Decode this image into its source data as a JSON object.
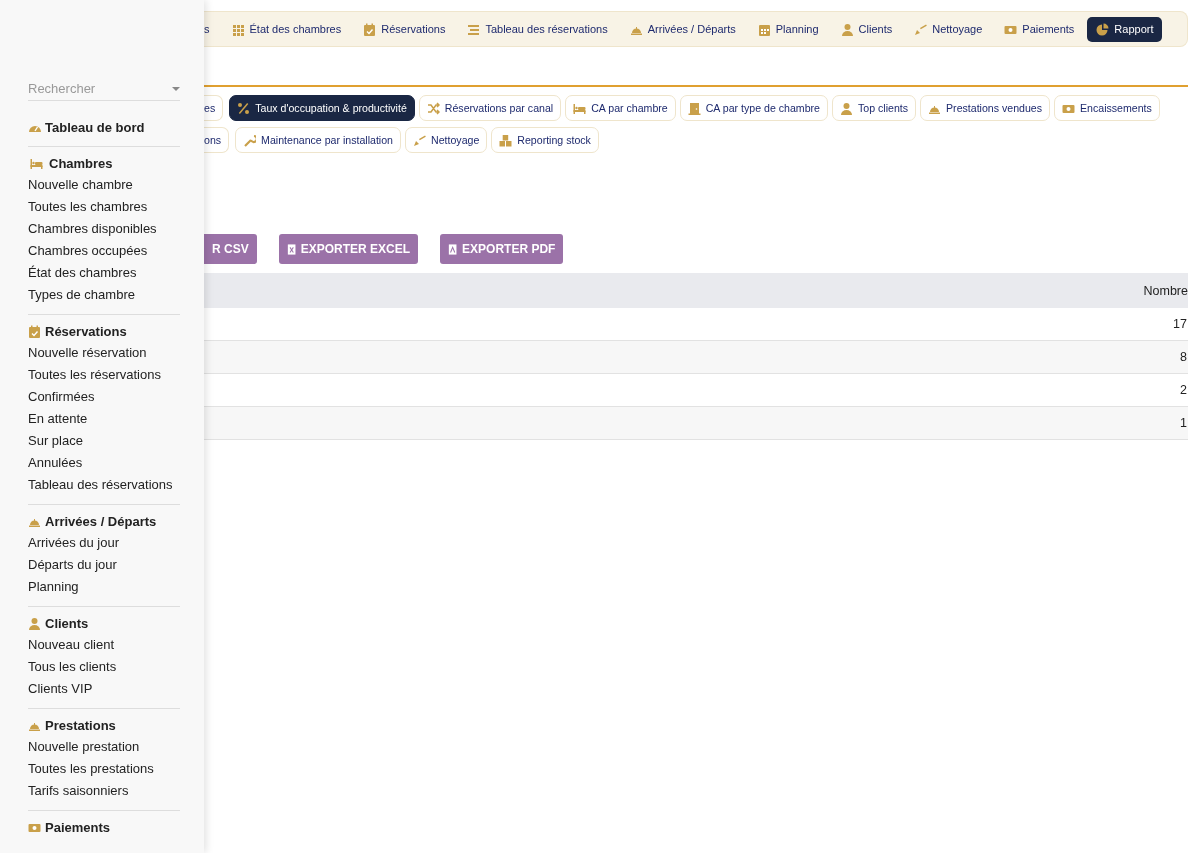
{
  "sidebar": {
    "search": {
      "placeholder": "Rechercher"
    },
    "sections": [
      {
        "title": "Tableau de bord"
      },
      {
        "title": "Chambres",
        "items": [
          "Nouvelle chambre",
          "Toutes les chambres",
          "Chambres disponibles",
          "Chambres occupées",
          "État des chambres",
          "Types de chambre"
        ]
      },
      {
        "title": "Réservations",
        "items": [
          "Nouvelle réservation",
          "Toutes les réservations",
          "Confirmées",
          "En attente",
          "Sur place",
          "Annulées",
          "Tableau des réservations"
        ]
      },
      {
        "title": "Arrivées / Départs",
        "items": [
          "Arrivées du jour",
          "Départs du jour",
          "Planning"
        ]
      },
      {
        "title": "Clients",
        "items": [
          "Nouveau client",
          "Tous les clients",
          "Clients VIP"
        ]
      },
      {
        "title": "Prestations",
        "items": [
          "Nouvelle prestation",
          "Toutes les prestations",
          "Tarifs saisonniers"
        ]
      },
      {
        "title": "Paiements"
      }
    ]
  },
  "top_nav": [
    {
      "label": "s",
      "selected": false
    },
    {
      "label": "État des chambres",
      "selected": false
    },
    {
      "label": "Réservations",
      "selected": false
    },
    {
      "label": "Tableau des réservations",
      "selected": false
    },
    {
      "label": "Arrivées / Départs",
      "selected": false
    },
    {
      "label": "Planning",
      "selected": false
    },
    {
      "label": "Clients",
      "selected": false
    },
    {
      "label": "Nettoyage",
      "selected": false
    },
    {
      "label": "Paiements",
      "selected": false
    },
    {
      "label": "Rapport",
      "selected": true
    }
  ],
  "report_tabs": [
    [
      {
        "label": "es",
        "selected": false
      },
      {
        "label": "Taux d'occupation & productivité",
        "selected": true
      },
      {
        "label": "Réservations par canal",
        "selected": false
      },
      {
        "label": "CA par chambre",
        "selected": false
      },
      {
        "label": "CA par type de chambre",
        "selected": false
      },
      {
        "label": "Top clients",
        "selected": false
      },
      {
        "label": "Prestations vendues",
        "selected": false
      },
      {
        "label": "Encaissements",
        "selected": false
      }
    ],
    [
      {
        "label": "ons",
        "selected": false
      },
      {
        "label": "Maintenance par installation",
        "selected": false
      },
      {
        "label": "Nettoyage",
        "selected": false
      },
      {
        "label": "Reporting stock",
        "selected": false
      }
    ]
  ],
  "export_buttons": [
    "R CSV",
    "EXPORTER EXCEL",
    "EXPORTER PDF"
  ],
  "table": {
    "columns": [
      "Nombre"
    ],
    "rows": [
      [
        "17"
      ],
      [
        "8"
      ],
      [
        "2"
      ],
      [
        "1"
      ]
    ]
  }
}
